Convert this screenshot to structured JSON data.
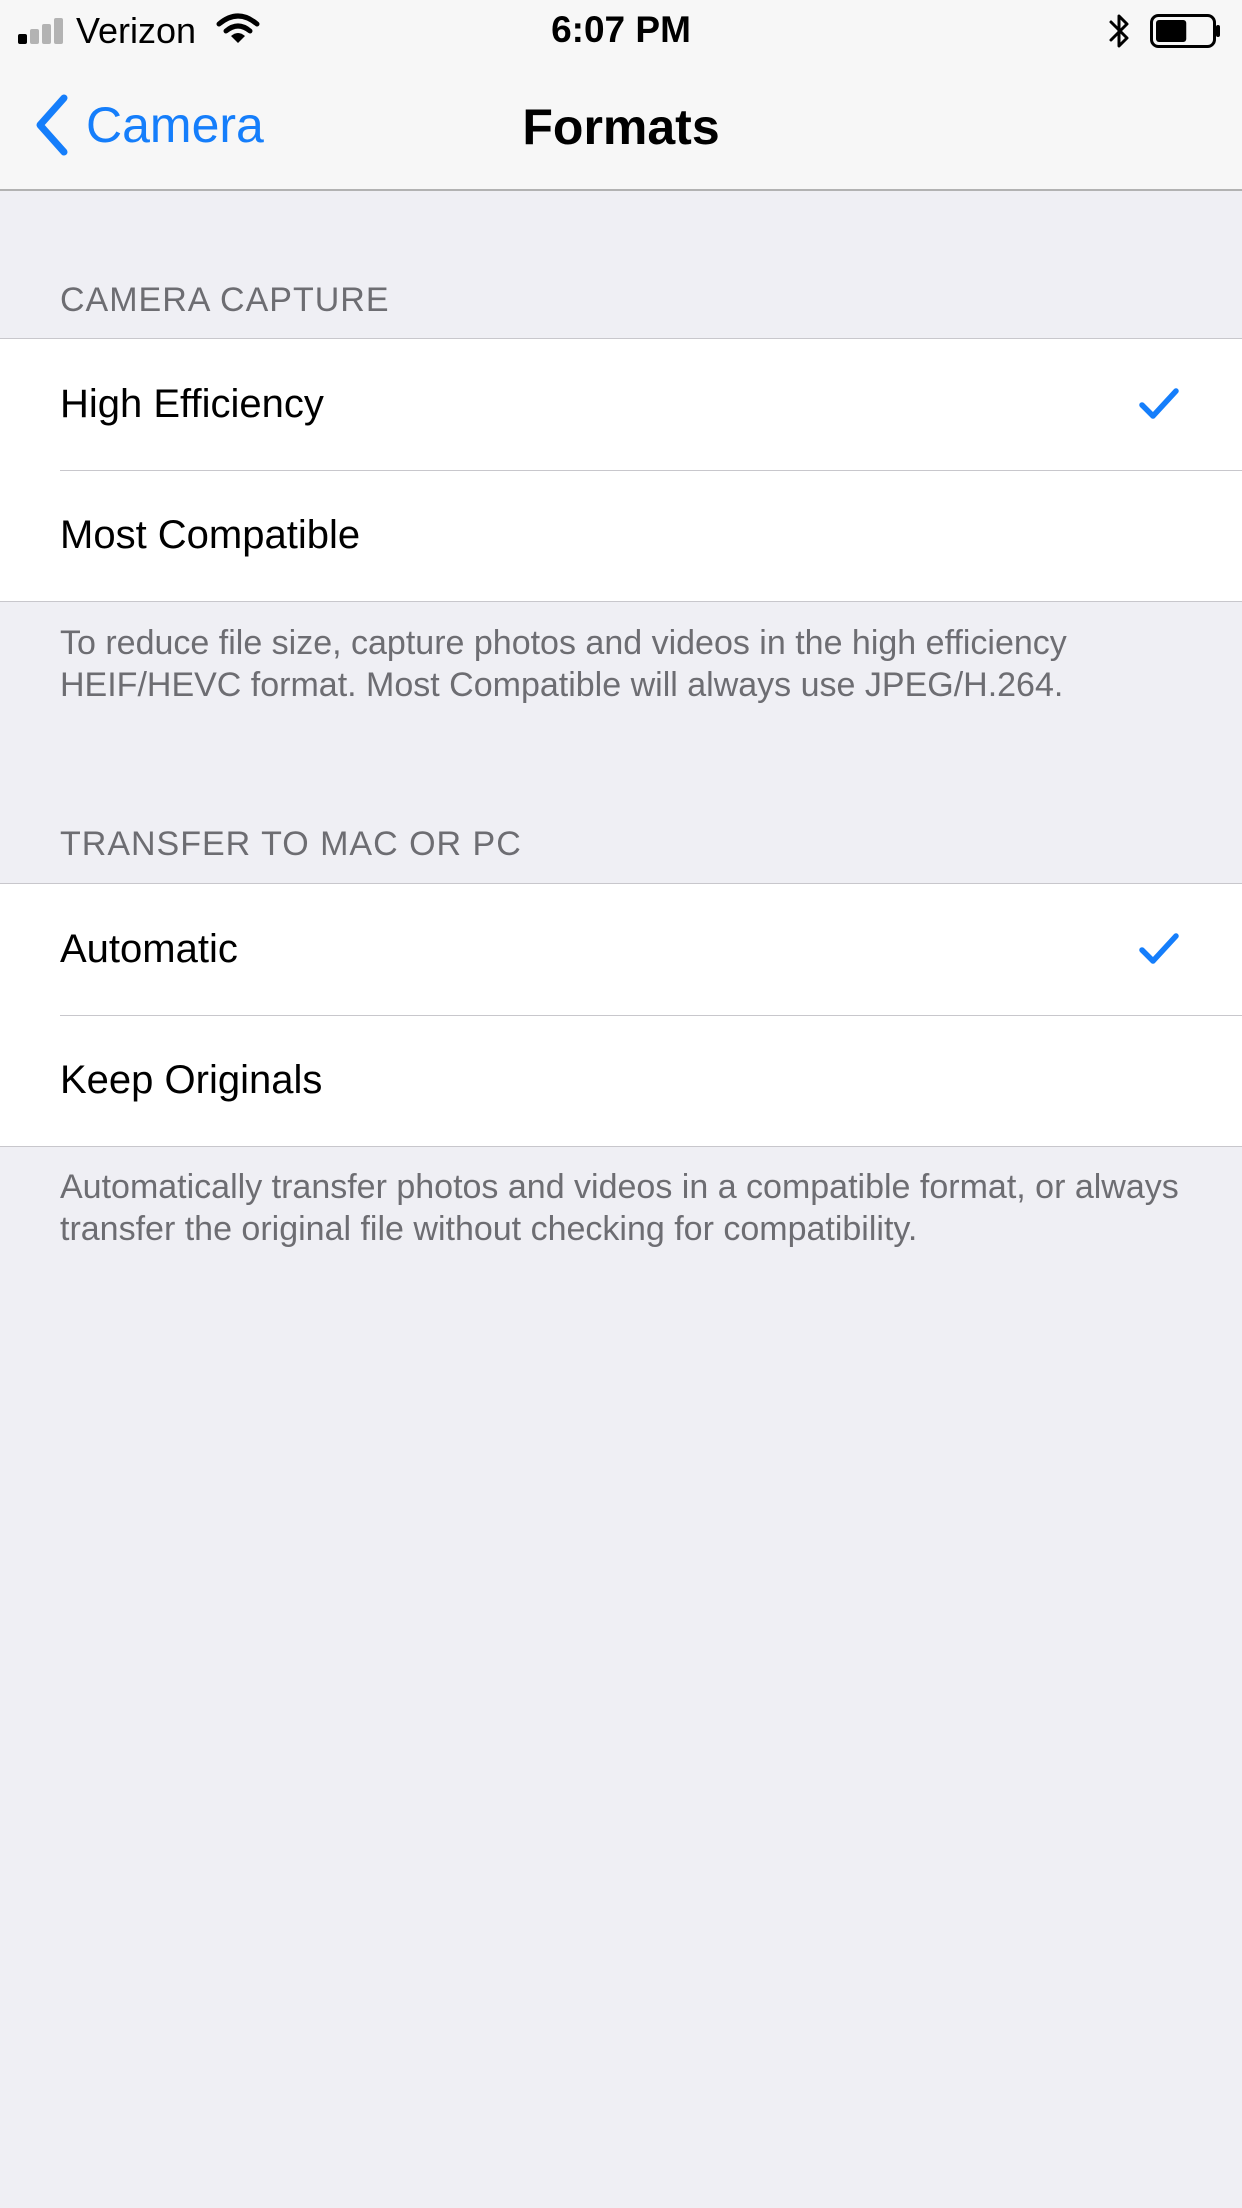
{
  "status_bar": {
    "carrier": "Verizon",
    "time": "6:07 PM",
    "signal_icon": "signal-bars-icon",
    "wifi_icon": "wifi-icon",
    "bluetooth_icon": "bluetooth-icon",
    "battery_icon": "battery-icon",
    "battery_level": 0.55
  },
  "nav": {
    "back_label": "Camera",
    "title": "Formats",
    "back_icon": "chevron-left-icon"
  },
  "accent_color": "#157efb",
  "sections": [
    {
      "header": "CAMERA CAPTURE",
      "options": [
        {
          "label": "High Efficiency",
          "selected": true
        },
        {
          "label": "Most Compatible",
          "selected": false
        }
      ],
      "footer": "To reduce file size, capture photos and videos in the high efficiency HEIF/HEVC format. Most Compatible will always use JPEG/H.264."
    },
    {
      "header": "TRANSFER TO MAC OR PC",
      "options": [
        {
          "label": "Automatic",
          "selected": true
        },
        {
          "label": "Keep Originals",
          "selected": false
        }
      ],
      "footer": "Automatically transfer photos and videos in a compatible format, or always transfer the original file without checking for compatibility."
    }
  ]
}
